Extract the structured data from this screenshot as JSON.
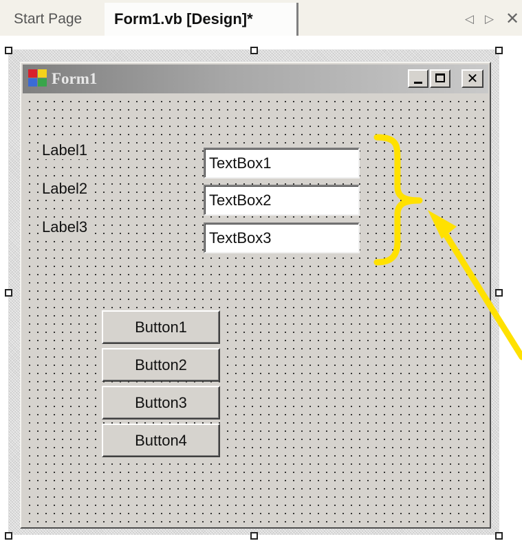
{
  "tabs": {
    "start_page": "Start Page",
    "active": "Form1.vb [Design]*",
    "nav_left": "◁",
    "nav_right": "▷",
    "close": "✕"
  },
  "form": {
    "title": "Form1",
    "caption_close": "✕"
  },
  "labels": [
    "Label1",
    "Label2",
    "Label3"
  ],
  "textboxes": [
    "TextBox1",
    "TextBox2",
    "TextBox3"
  ],
  "buttons": [
    "Button1",
    "Button2",
    "Button3",
    "Button4"
  ],
  "colors": {
    "annotation": "#ffe100",
    "form_face": "#d6d3ce"
  }
}
